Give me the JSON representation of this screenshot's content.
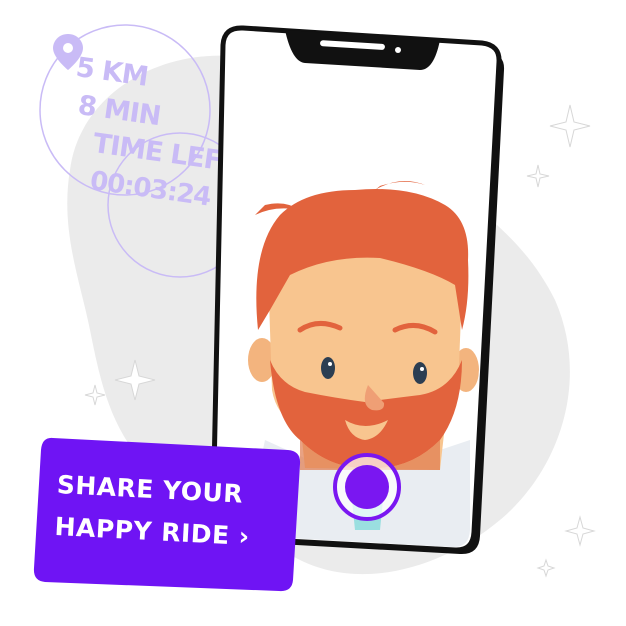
{
  "ride_stats": {
    "distance": "5 KM",
    "duration": "8 MIN",
    "time_left_label": "TIME LEFT",
    "time_left_value": "00:03:24"
  },
  "cta": {
    "line1": "SHARE YOUR",
    "line2": "HAPPY RIDE",
    "chevron": "›",
    "color": "#6f14f4"
  },
  "icons": {
    "location": "map-pin-icon",
    "record": "record-button-icon",
    "sparkles": "sparkle-icon"
  },
  "colors": {
    "overlay_text": "#c9bbf6",
    "blob": "#ebebeb",
    "phone_frame": "#111111",
    "hair": "#e2633d",
    "skin": "#f8c58f",
    "record_button": "#7a17f1"
  }
}
